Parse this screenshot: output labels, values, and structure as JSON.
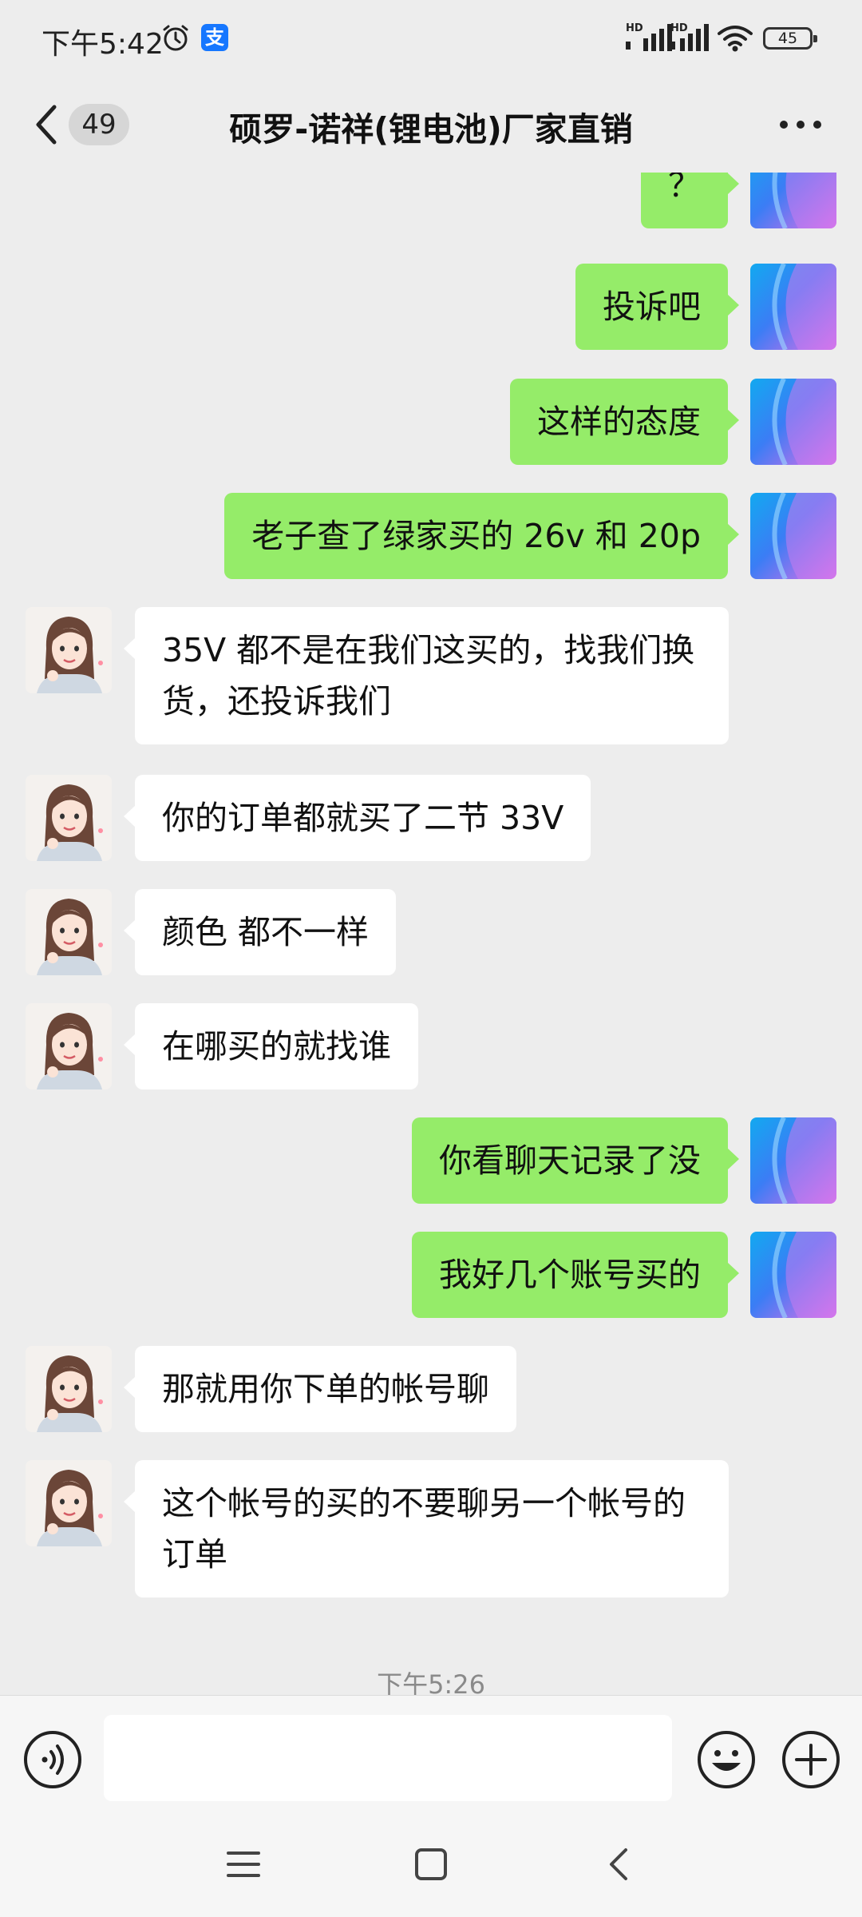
{
  "status_bar": {
    "time": "下午5:42",
    "app_icon_char": "支",
    "hd_label_1": "HD",
    "hd_label_2": "HD",
    "battery": "45"
  },
  "nav": {
    "unread_count": "49",
    "title": "硕罗-诺祥(锂电池)厂家直销"
  },
  "messages": [
    {
      "side": "out",
      "text": "？"
    },
    {
      "side": "out",
      "text": "投诉吧"
    },
    {
      "side": "out",
      "text": "这样的态度"
    },
    {
      "side": "out",
      "text": "老子查了绿家买的 26v 和 20p"
    },
    {
      "side": "in",
      "text": "35V 都不是在我们这买的，找我们换货，还投诉我们"
    },
    {
      "side": "in",
      "text": "你的订单都就买了二节 33V"
    },
    {
      "side": "in",
      "text": "颜色 都不一样"
    },
    {
      "side": "in",
      "text": "在哪买的就找谁"
    },
    {
      "side": "out",
      "text": "你看聊天记录了没"
    },
    {
      "side": "out",
      "text": "我好几个账号买的"
    },
    {
      "side": "in",
      "text": "那就用你下单的帐号聊"
    },
    {
      "side": "in",
      "text": "这个帐号的买的不要聊另一个帐号的订单"
    }
  ],
  "timestamp": "下午5:26",
  "input": {
    "placeholder": "",
    "value": ""
  },
  "colors": {
    "outgoing_bubble": "#95ec69",
    "incoming_bubble": "#ffffff",
    "background": "#ededed"
  }
}
